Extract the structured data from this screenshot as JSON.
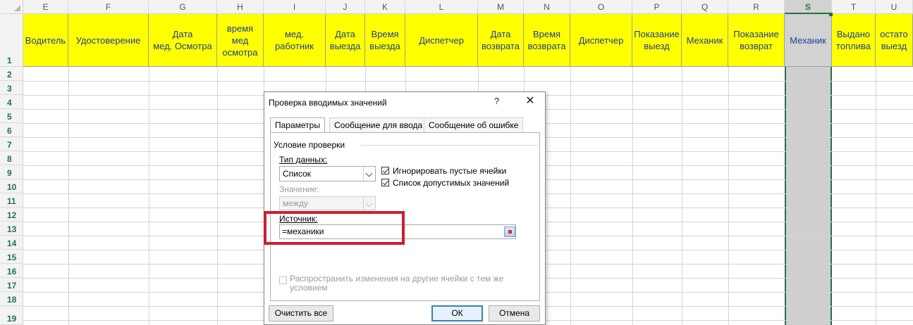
{
  "columns": [
    "E",
    "F",
    "G",
    "H",
    "I",
    "J",
    "K",
    "L",
    "M",
    "N",
    "O",
    "P",
    "Q",
    "R",
    "S",
    "T",
    "U"
  ],
  "selected_column": "S",
  "rows": [
    "1",
    "2",
    "3",
    "4",
    "5",
    "6",
    "7",
    "8",
    "9",
    "10",
    "11",
    "12",
    "13",
    "14",
    "15",
    "16",
    "17",
    "18",
    "19"
  ],
  "header_cells": [
    "Водитель",
    "Удостоверение",
    "Дата\nмед. Осмотра",
    "время\nмед\nосмотра",
    "мед.\nработник",
    "Дата\nвыезда",
    "Время\nвыезда",
    "Диспетчер",
    "Дата\nвозврата",
    "Время\nвозврата",
    "Диспетчер",
    "Показание\nвыезд",
    "Механик",
    "Показание\nвозврат",
    "Механик",
    "Выдано\nтоплива",
    "остато\nвыезд"
  ],
  "dialog": {
    "title": "Проверка вводимых значений",
    "help": "?",
    "close": "✕",
    "tabs": [
      "Параметры",
      "Сообщение для ввода",
      "Сообщение об ошибке"
    ],
    "group_label": "Условие проверки",
    "data_type_label": "Тип данных:",
    "data_type_value": "Список",
    "ignore_blank_label": "Игнорировать пустые ячейки",
    "ignore_blank_checked": true,
    "dropdown_label": "Список допустимых значений",
    "dropdown_checked": true,
    "value_label": "Значение:",
    "value_value": "между",
    "source_label": "Источник:",
    "source_value": "=механики",
    "apply_all_label": "Распространить изменения на другие ячейки с тем же условием",
    "apply_all_checked": false,
    "clear_all_button": "Очистить все",
    "ok_button": "ОК",
    "cancel_button": "Отмена"
  },
  "colors": {
    "header_fill": "#ffff00",
    "header_text": "#1f3f9a",
    "selection": "#217346",
    "highlight_box": "#cc1f2f"
  }
}
